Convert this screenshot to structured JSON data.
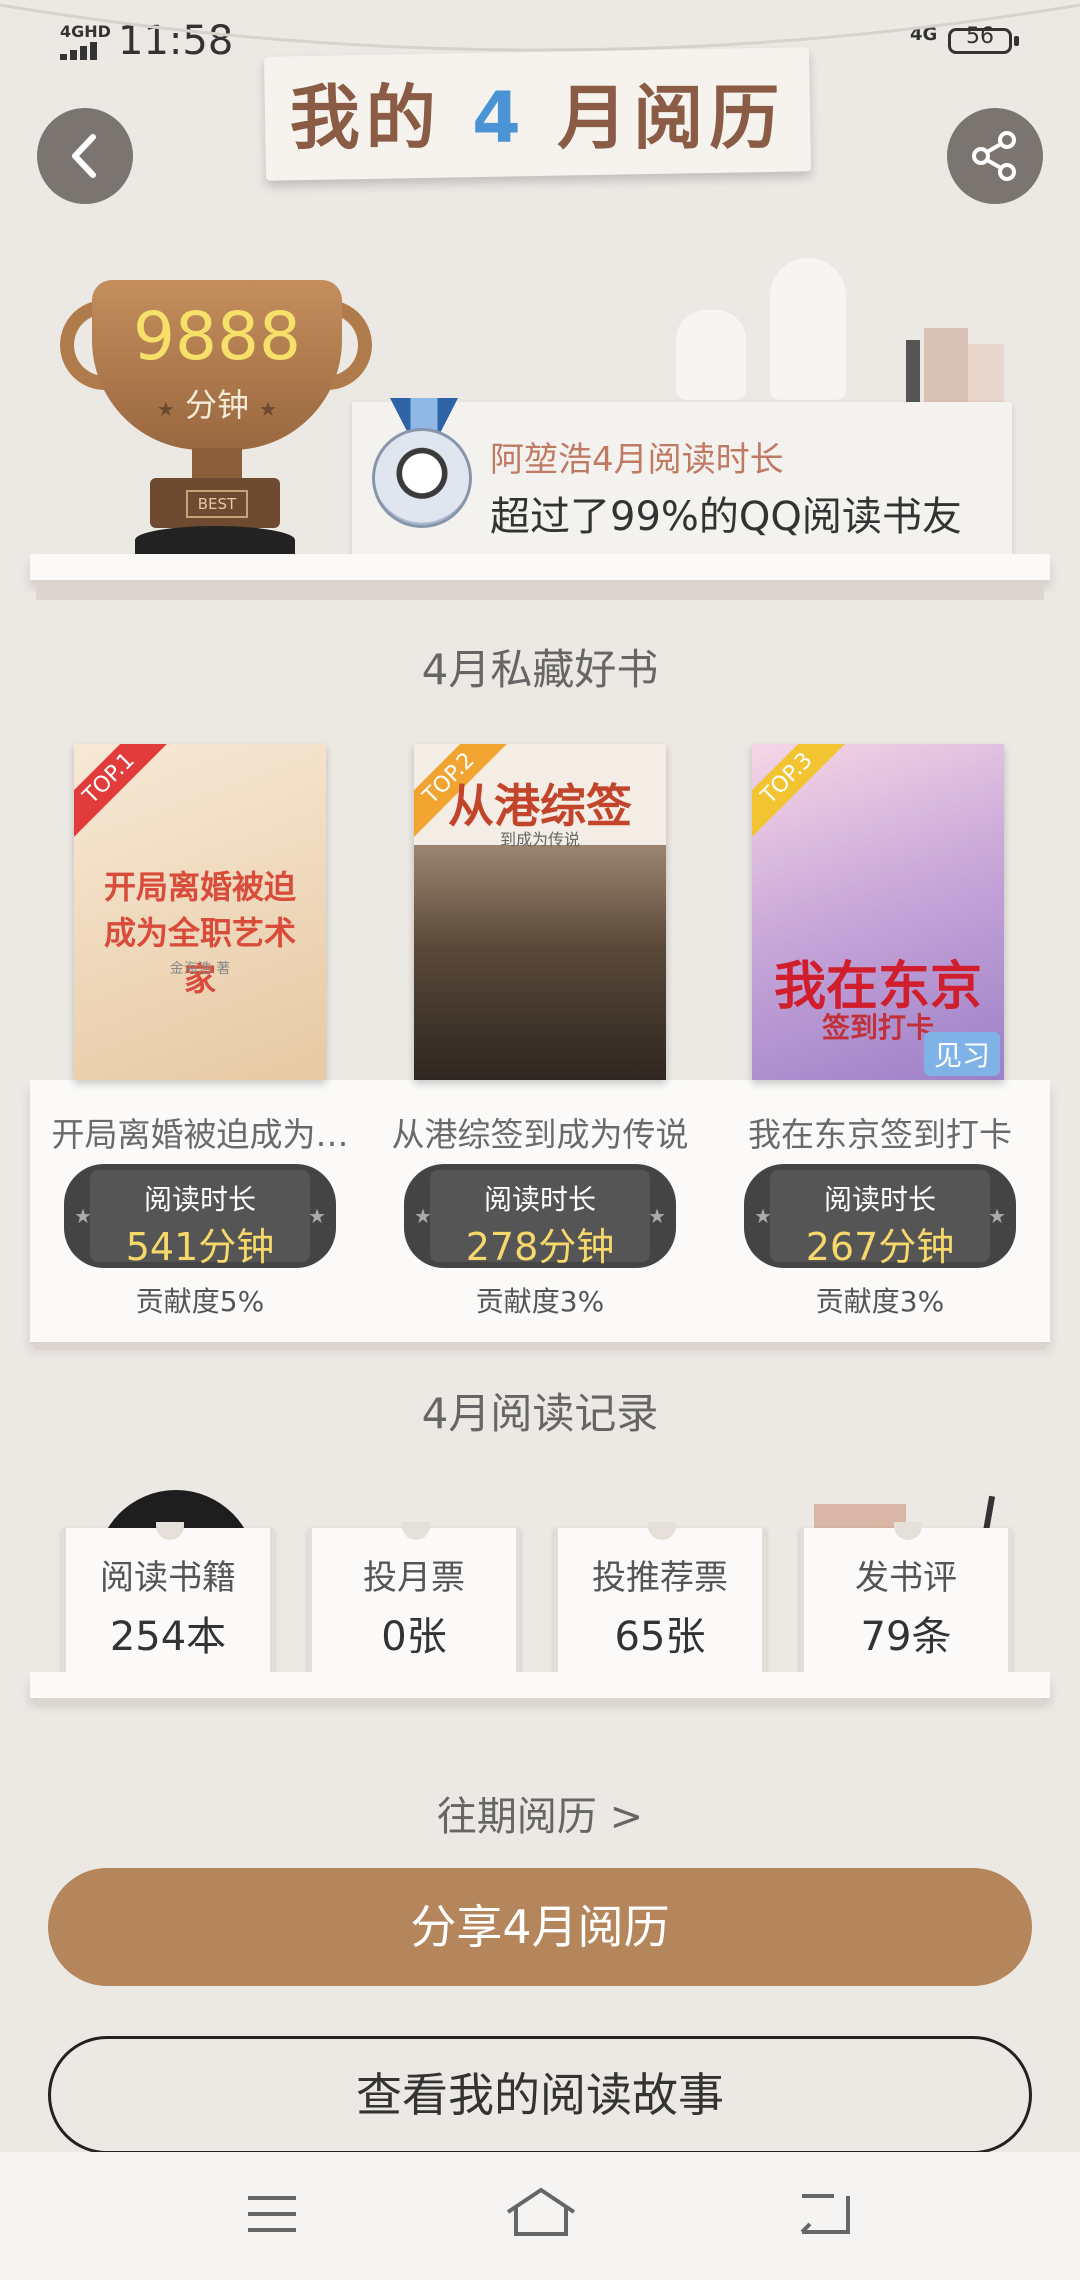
{
  "status_bar": {
    "network_left": "4GHD",
    "time": "11:58",
    "network_right": "4G",
    "battery": "56"
  },
  "banner": {
    "prefix": "我的",
    "month": "4",
    "suffix": "月阅历"
  },
  "trophy": {
    "minutes": "9888",
    "unit": "分钟",
    "badge": "BEST"
  },
  "rank": {
    "line1": "阿堃浩4月阅读时长",
    "line2": "超过了99%的QQ阅读书友"
  },
  "favorites": {
    "title": "4月私藏好书",
    "books": [
      {
        "tag": "TOP.1",
        "cover_title": "开局离婚被迫成为全职艺术家",
        "cover_author": "金海浩 著",
        "title": "开局离婚被迫成为…",
        "label": "阅读时长",
        "minutes": "541分钟",
        "contribution": "贡献度5%"
      },
      {
        "tag": "TOP.2",
        "cover_title": "从港综签",
        "cover_subtitle": "到成为传说",
        "title": "从港综签到成为传说",
        "label": "阅读时长",
        "minutes": "278分钟",
        "contribution": "贡献度3%"
      },
      {
        "tag": "TOP.3",
        "cover_title": "我在东京",
        "cover_subtitle": "签到打卡",
        "cover_badge": "见习",
        "title": "我在东京签到打卡",
        "label": "阅读时长",
        "minutes": "267分钟",
        "contribution": "贡献度3%"
      }
    ]
  },
  "records": {
    "title": "4月阅读记录",
    "items": [
      {
        "label": "阅读书籍",
        "value": "254本"
      },
      {
        "label": "投月票",
        "value": "0张"
      },
      {
        "label": "投推荐票",
        "value": "65张"
      },
      {
        "label": "发书评",
        "value": "79条"
      }
    ]
  },
  "history_link": "往期阅历 >",
  "share_button": "分享4月阅历",
  "story_button": "查看我的阅读故事",
  "colors": {
    "accent": "#b5865c",
    "gold": "#f6d96a",
    "background": "#ece8e4"
  }
}
